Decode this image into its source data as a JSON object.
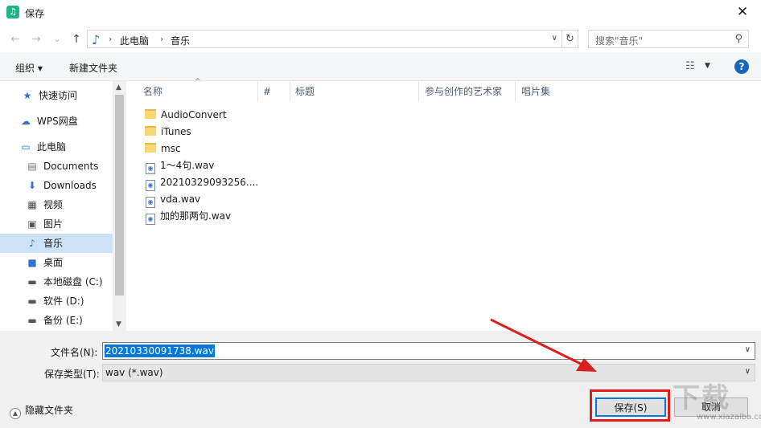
{
  "window": {
    "title": "保存",
    "app_icon": "music-note-icon"
  },
  "nav_buttons": {
    "back": "←",
    "forward": "→",
    "recent": "⌄",
    "up": "↑"
  },
  "address": {
    "segments": [
      "此电脑",
      "音乐"
    ],
    "separator": "›"
  },
  "search": {
    "placeholder": "搜索\"音乐\""
  },
  "toolbar": {
    "organize": "组织 ▾",
    "new_folder": "新建文件夹"
  },
  "nav_pane": {
    "items": [
      {
        "label": "快速访问",
        "icon": "star-icon"
      },
      {
        "label": "WPS网盘",
        "icon": "cloud-icon"
      },
      {
        "label": "此电脑",
        "icon": "computer-icon"
      },
      {
        "label": "Documents",
        "icon": "document-icon"
      },
      {
        "label": "Downloads",
        "icon": "download-icon"
      },
      {
        "label": "视频",
        "icon": "video-icon"
      },
      {
        "label": "图片",
        "icon": "picture-icon"
      },
      {
        "label": "音乐",
        "icon": "music-icon",
        "selected": true
      },
      {
        "label": "桌面",
        "icon": "desktop-icon"
      },
      {
        "label": "本地磁盘 (C:)",
        "icon": "drive-icon"
      },
      {
        "label": "软件 (D:)",
        "icon": "drive-icon"
      },
      {
        "label": "备份 (E:)",
        "icon": "drive-icon"
      }
    ]
  },
  "columns": [
    "名称",
    "#",
    "标题",
    "参与创作的艺术家",
    "唱片集"
  ],
  "files": [
    {
      "name": "AudioConvert",
      "type": "folder"
    },
    {
      "name": "iTunes",
      "type": "folder"
    },
    {
      "name": "msc",
      "type": "folder"
    },
    {
      "name": "1～4句.wav",
      "type": "wav"
    },
    {
      "name": "20210329093256....",
      "type": "wav"
    },
    {
      "name": "vda.wav",
      "type": "wav"
    },
    {
      "name": "加的那两句.wav",
      "type": "wav"
    }
  ],
  "form": {
    "filename_label": "文件名(N):",
    "filename_value": "20210330091738.wav",
    "filetype_label": "保存类型(T):",
    "filetype_value": "wav (*.wav)"
  },
  "footer": {
    "hide_folders": "隐藏文件夹",
    "save": "保存(S)",
    "cancel": "取消"
  },
  "watermark": {
    "text": "下载",
    "url": "www.xiazaiba.com"
  },
  "colors": {
    "accent": "#0078d7",
    "selection": "#cce2f6",
    "annotation": "#e01b1b"
  }
}
